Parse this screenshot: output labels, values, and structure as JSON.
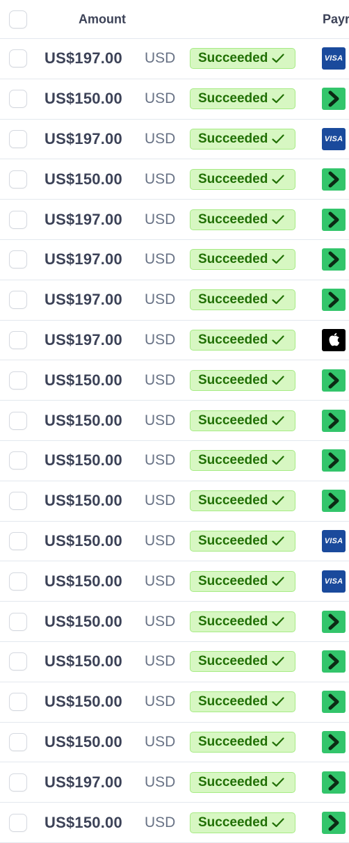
{
  "header": {
    "amount_label": "Amount",
    "payment_label": "Payr"
  },
  "rows": [
    {
      "amount": "US$197.00",
      "currency": "USD",
      "status": "Succeeded",
      "payment_method": "visa",
      "visa_text": "VISA"
    },
    {
      "amount": "US$150.00",
      "currency": "USD",
      "status": "Succeeded",
      "payment_method": "link"
    },
    {
      "amount": "US$197.00",
      "currency": "USD",
      "status": "Succeeded",
      "payment_method": "visa",
      "visa_text": "VISA"
    },
    {
      "amount": "US$150.00",
      "currency": "USD",
      "status": "Succeeded",
      "payment_method": "link"
    },
    {
      "amount": "US$197.00",
      "currency": "USD",
      "status": "Succeeded",
      "payment_method": "link"
    },
    {
      "amount": "US$197.00",
      "currency": "USD",
      "status": "Succeeded",
      "payment_method": "link"
    },
    {
      "amount": "US$197.00",
      "currency": "USD",
      "status": "Succeeded",
      "payment_method": "link"
    },
    {
      "amount": "US$197.00",
      "currency": "USD",
      "status": "Succeeded",
      "payment_method": "apple-pay"
    },
    {
      "amount": "US$150.00",
      "currency": "USD",
      "status": "Succeeded",
      "payment_method": "link"
    },
    {
      "amount": "US$150.00",
      "currency": "USD",
      "status": "Succeeded",
      "payment_method": "link"
    },
    {
      "amount": "US$150.00",
      "currency": "USD",
      "status": "Succeeded",
      "payment_method": "link"
    },
    {
      "amount": "US$150.00",
      "currency": "USD",
      "status": "Succeeded",
      "payment_method": "link"
    },
    {
      "amount": "US$150.00",
      "currency": "USD",
      "status": "Succeeded",
      "payment_method": "visa",
      "visa_text": "VISA"
    },
    {
      "amount": "US$150.00",
      "currency": "USD",
      "status": "Succeeded",
      "payment_method": "visa",
      "visa_text": "VISA"
    },
    {
      "amount": "US$150.00",
      "currency": "USD",
      "status": "Succeeded",
      "payment_method": "link"
    },
    {
      "amount": "US$150.00",
      "currency": "USD",
      "status": "Succeeded",
      "payment_method": "link"
    },
    {
      "amount": "US$150.00",
      "currency": "USD",
      "status": "Succeeded",
      "payment_method": "link"
    },
    {
      "amount": "US$150.00",
      "currency": "USD",
      "status": "Succeeded",
      "payment_method": "link"
    },
    {
      "amount": "US$197.00",
      "currency": "USD",
      "status": "Succeeded",
      "payment_method": "link"
    },
    {
      "amount": "US$150.00",
      "currency": "USD",
      "status": "Succeeded",
      "payment_method": "link"
    }
  ],
  "colors": {
    "badge_bg": "#d7f7c2",
    "badge_border": "#a6eb84",
    "badge_text": "#217005",
    "visa": "#1a4a9c",
    "link": "#33c56b",
    "apple": "#000000"
  }
}
